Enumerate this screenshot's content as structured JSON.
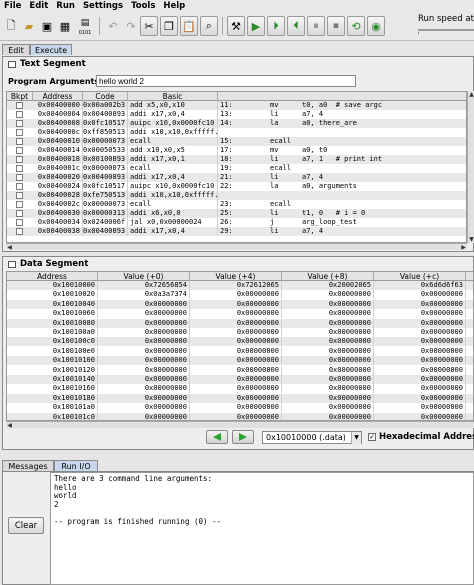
{
  "menu": [
    "File",
    "Edit",
    "Run",
    "Settings",
    "Tools",
    "Help"
  ],
  "toolbar": {
    "run_speed_label": "Run speed at",
    "dump_label": "0101",
    "icons": [
      "new-file-icon",
      "open-file-icon",
      "save-icon",
      "save-all-icon",
      "dump-memory-icon",
      "undo-icon",
      "redo-icon",
      "cut-icon",
      "copy-icon",
      "paste-icon",
      "find-replace-icon",
      "assemble-icon",
      "run-icon",
      "step-icon",
      "backstep-icon",
      "pause-icon",
      "stop-icon",
      "reset-icon",
      "help-icon"
    ]
  },
  "tabs": {
    "edit": "Edit",
    "execute": "Execute"
  },
  "text_segment": {
    "title": "Text Segment",
    "prog_args_label": "Program Arguments:",
    "prog_args_value": "hello world 2",
    "headers": [
      "Bkpt",
      "Address",
      "Code",
      "Basic",
      "Source"
    ],
    "rows": [
      [
        "0x00400000",
        "0x00a002b3",
        "add x5,x0,x10",
        "11:",
        "mv",
        "t0, a0  # save argc"
      ],
      [
        "0x00400004",
        "0x00400893",
        "addi x17,x0,4",
        "13:",
        "li",
        "a7, 4"
      ],
      [
        "0x00400008",
        "0x0fc10517",
        "auipc x10,0x0000fc10",
        "14:",
        "la",
        "a0, there_are"
      ],
      [
        "0x0040000c",
        "0xff850513",
        "addi x10,x10,0xfffff...",
        "",
        "",
        ""
      ],
      [
        "0x00400010",
        "0x00000073",
        "ecall",
        "15:",
        "ecall",
        ""
      ],
      [
        "0x00400014",
        "0x00050533",
        "add x10,x0,x5",
        "17:",
        "mv",
        "a0, t0"
      ],
      [
        "0x00400018",
        "0x00100893",
        "addi x17,x0,1",
        "18:",
        "li",
        "a7, 1   # print int"
      ],
      [
        "0x0040001c",
        "0x00000073",
        "ecall",
        "19:",
        "ecall",
        ""
      ],
      [
        "0x00400020",
        "0x00400893",
        "addi x17,x0,4",
        "21:",
        "li",
        "a7, 4"
      ],
      [
        "0x00400024",
        "0x0fc10517",
        "auipc x10,0x0000fc10",
        "22:",
        "la",
        "a0, arguments"
      ],
      [
        "0x00400028",
        "0xfe750513",
        "addi x10,x10,0xfffff...",
        "",
        "",
        ""
      ],
      [
        "0x0040002c",
        "0x00000073",
        "ecall",
        "23:",
        "ecall",
        ""
      ],
      [
        "0x00400030",
        "0x00000313",
        "addi x6,x0,0",
        "25:",
        "li",
        "t1, 0   # i = 0"
      ],
      [
        "0x00400034",
        "0x0240006f",
        "jal x0,0x00000024",
        "26:",
        "j",
        "arg_loop_test"
      ],
      [
        "0x00400038",
        "0x00400893",
        "addi x17,x0,4",
        "29:",
        "li",
        "a7, 4"
      ]
    ]
  },
  "data_segment": {
    "title": "Data Segment",
    "headers": [
      "Address",
      "Value (+0)",
      "Value (+4)",
      "Value (+8)",
      "Value (+c)"
    ],
    "rows": [
      [
        "0x10010000",
        "0x72656854",
        "0x72612065",
        "0x20002065",
        "0x6d6d6f63"
      ],
      [
        "0x10010020",
        "0x0a3a7374",
        "0x00000000",
        "0x00000000",
        "0x00000000"
      ],
      [
        "0x10010040",
        "0x00000000",
        "0x00000000",
        "0x00000000",
        "0x00000000"
      ],
      [
        "0x10010060",
        "0x00000000",
        "0x00000000",
        "0x00000000",
        "0x00000000"
      ],
      [
        "0x10010080",
        "0x00000000",
        "0x00000000",
        "0x00000000",
        "0x00000000"
      ],
      [
        "0x100100a0",
        "0x00000000",
        "0x00000000",
        "0x00000000",
        "0x00000000"
      ],
      [
        "0x100100c0",
        "0x00000000",
        "0x00000000",
        "0x00000000",
        "0x00000000"
      ],
      [
        "0x100100e0",
        "0x00000000",
        "0x00000000",
        "0x00000000",
        "0x00000000"
      ],
      [
        "0x10010100",
        "0x00000000",
        "0x00000000",
        "0x00000000",
        "0x00000000"
      ],
      [
        "0x10010120",
        "0x00000000",
        "0x00000000",
        "0x00000000",
        "0x00000000"
      ],
      [
        "0x10010140",
        "0x00000000",
        "0x00000000",
        "0x00000000",
        "0x00000000"
      ],
      [
        "0x10010160",
        "0x00000000",
        "0x00000000",
        "0x00000000",
        "0x00000000"
      ],
      [
        "0x10010180",
        "0x00000000",
        "0x00000000",
        "0x00000000",
        "0x00000000"
      ],
      [
        "0x100101a0",
        "0x00000000",
        "0x00000000",
        "0x00000000",
        "0x00000000"
      ],
      [
        "0x100101c0",
        "0x00000000",
        "0x00000000",
        "0x00000000",
        "0x00000000"
      ]
    ],
    "segment_select": "0x10010000 (.data)",
    "hex_addresses_label": "Hexadecimal Addresses",
    "hex_addresses_checked": true
  },
  "bottom_tabs": {
    "messages": "Messages",
    "run_io": "Run I/O"
  },
  "console": {
    "clear_label": "Clear",
    "lines": [
      "There are 3 command line arguments:",
      "hello",
      "world",
      "2",
      "",
      "-- program is finished running (0) --"
    ]
  },
  "colors": {
    "selected_tab": "#c8d8ec",
    "nav_arrow": "#2ea02e",
    "row_alt": "#e8e8e8"
  }
}
